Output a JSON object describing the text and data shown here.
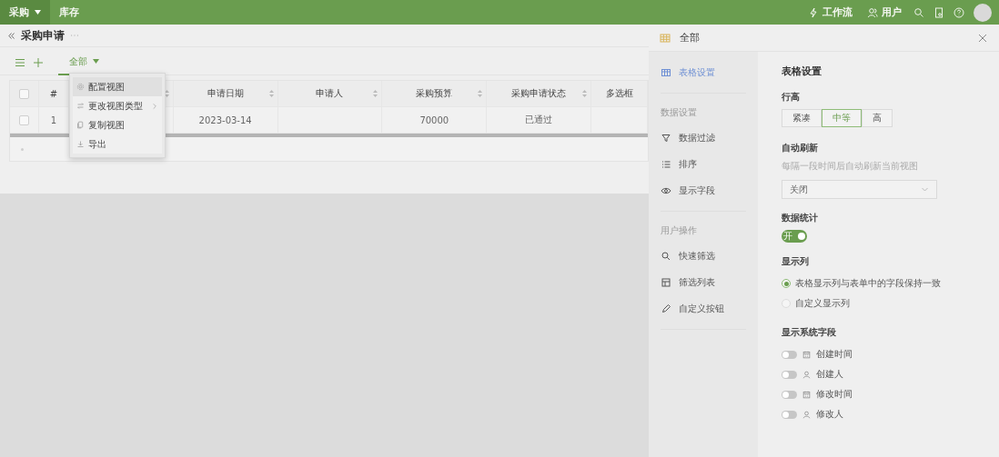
{
  "topbar": {
    "nav": [
      {
        "label": "采购",
        "selected": true,
        "caret": true
      },
      {
        "label": "库存",
        "selected": false,
        "caret": false
      }
    ],
    "actions": [
      {
        "label": "工作流"
      },
      {
        "label": "用户"
      }
    ]
  },
  "page": {
    "title": "采购申请",
    "views": [
      {
        "label": "全部",
        "selected": true
      }
    ]
  },
  "table": {
    "header_checked": false,
    "columns": [
      {
        "label": "#",
        "sortable": false
      },
      {
        "sortable": true
      },
      {
        "label": "申请日期",
        "sortable": true
      },
      {
        "label": "申请人",
        "sortable": true
      },
      {
        "label": "采购预算",
        "sortable": true
      },
      {
        "label": "采购申请状态",
        "sortable": true
      },
      {
        "label": "多选框",
        "sortable": false
      }
    ],
    "rows": [
      {
        "checked": false,
        "cells": [
          "1",
          null,
          "2023-03-14",
          null,
          "70000",
          "已通过",
          null
        ]
      }
    ]
  },
  "view_menu": [
    {
      "label": "配置视图",
      "selected": true,
      "submenu": false
    },
    {
      "label": "更改视图类型",
      "selected": false,
      "submenu": true
    },
    {
      "label": "复制视图",
      "selected": false,
      "submenu": false
    },
    {
      "label": "导出",
      "selected": false,
      "submenu": false
    }
  ],
  "panel": {
    "title": "全部",
    "sidebar": [
      {
        "kind": "item",
        "label": "表格设置",
        "selected": true
      },
      {
        "kind": "divider"
      },
      {
        "kind": "group",
        "label": "数据设置"
      },
      {
        "kind": "item",
        "label": "数据过滤",
        "selected": false
      },
      {
        "kind": "item",
        "label": "排序",
        "selected": false
      },
      {
        "kind": "item",
        "label": "显示字段",
        "selected": false
      },
      {
        "kind": "divider"
      },
      {
        "kind": "group",
        "label": "用户操作"
      },
      {
        "kind": "item",
        "label": "快速筛选",
        "selected": false
      },
      {
        "kind": "item",
        "label": "筛选列表",
        "selected": false
      },
      {
        "kind": "item",
        "label": "自定义按钮",
        "selected": false
      },
      {
        "kind": "divider"
      }
    ],
    "heading": "表格设置",
    "row_height": {
      "label": "行高",
      "options": [
        {
          "label": "紧凑",
          "selected": false
        },
        {
          "label": "中等",
          "selected": true
        },
        {
          "label": "高",
          "selected": false
        }
      ]
    },
    "auto_refresh": {
      "label": "自动刷新",
      "hint": "每隔一段时间后自动刷新当前视图",
      "value": "关闭"
    },
    "stats": {
      "label": "数据统计",
      "on": true,
      "switch_text": "开"
    },
    "columns": {
      "label": "显示列",
      "options": [
        {
          "label": "表格显示列与表单中的字段保持一致",
          "selected": true
        },
        {
          "label": "自定义显示列",
          "selected": false
        }
      ]
    },
    "system_fields": {
      "label": "显示系统字段",
      "fields": [
        {
          "label": "创建时间",
          "kind": "time",
          "on": false
        },
        {
          "label": "创建人",
          "kind": "person",
          "on": false
        },
        {
          "label": "修改时间",
          "kind": "time",
          "on": false
        },
        {
          "label": "修改人",
          "kind": "person",
          "on": false
        }
      ]
    }
  }
}
